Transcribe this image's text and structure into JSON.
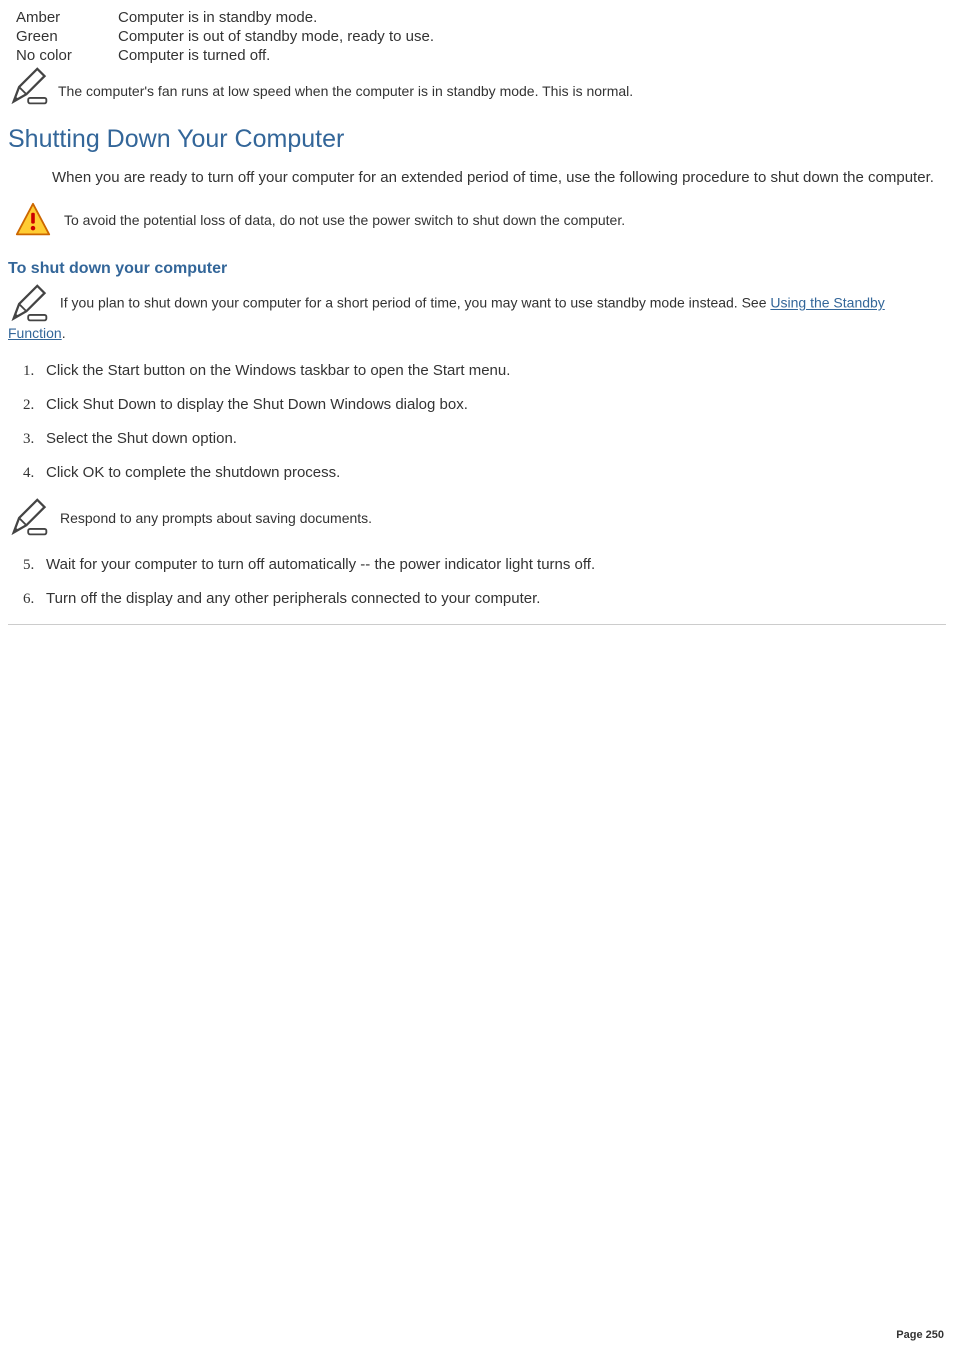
{
  "status_rows": [
    {
      "label": "Amber",
      "desc": "Computer is in standby mode."
    },
    {
      "label": "Green",
      "desc": "Computer is out of standby mode, ready to use."
    },
    {
      "label": "No color",
      "desc": "Computer is turned off."
    }
  ],
  "note_fan": "The computer's fan runs at low speed when the computer is in standby mode. This is normal.",
  "heading_shutdown": "Shutting Down Your Computer",
  "intro": "When you are ready to turn off your computer for an extended period of time, use the following procedure to shut down the computer.",
  "warn_text": "To avoid the potential loss of data, do not use the power switch to shut down the computer.",
  "subheading": "To shut down your computer",
  "note_standby_pre": "If you plan to shut down your computer for a short period of time, you may want to use standby mode instead. See ",
  "note_standby_link": "Using the Standby Function",
  "note_standby_post": ".",
  "steps_a": [
    "Click the Start button on the Windows   taskbar to open the Start menu.",
    "Click Shut Down to display the Shut Down Windows dialog box.",
    "Select the Shut down option.",
    "Click OK to complete the shutdown process."
  ],
  "mid_note": "Respond to any prompts about saving documents.",
  "steps_b": [
    "Wait for your computer to turn off automatically -- the power indicator light turns off.",
    "Turn off the display and any other peripherals connected to your computer."
  ],
  "page_footer": "Page 250"
}
